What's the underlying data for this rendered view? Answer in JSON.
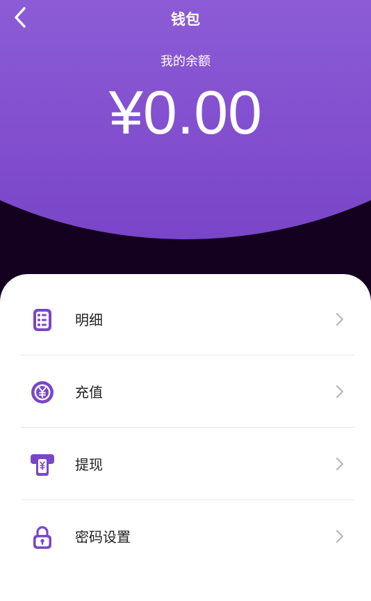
{
  "header": {
    "title": "钱包",
    "back_icon": "chevron-left-icon"
  },
  "balance": {
    "label": "我的余额",
    "amount": "¥0.00"
  },
  "colors": {
    "accent": "#7a46c8",
    "gradient_top": "#a57be6",
    "background_dark": "#14001f"
  },
  "menu": {
    "items": [
      {
        "label": "明细",
        "icon": "details-list-icon"
      },
      {
        "label": "充值",
        "icon": "yuan-coin-icon"
      },
      {
        "label": "提现",
        "icon": "withdraw-atm-icon"
      },
      {
        "label": "密码设置",
        "icon": "lock-icon"
      }
    ]
  }
}
